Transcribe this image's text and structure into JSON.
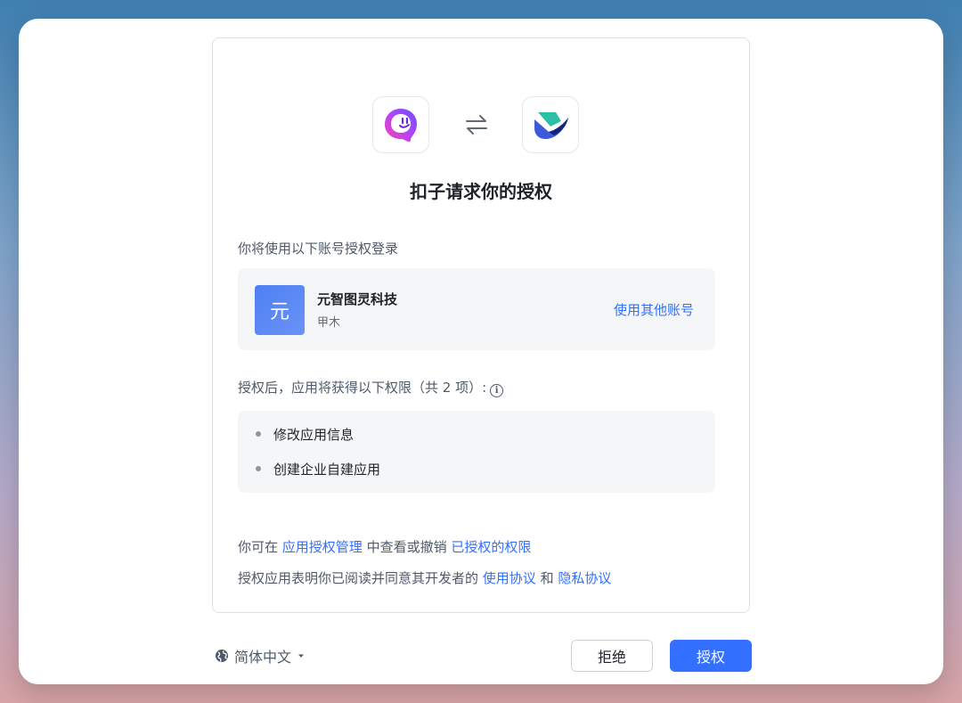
{
  "dialog": {
    "title": "扣子请求你的授权",
    "account_section_label": "你将使用以下账号授权登录",
    "account": {
      "avatar_text": "元",
      "name": "元智图灵科技",
      "sub": "甲木",
      "switch_label": "使用其他账号"
    },
    "perm_section_label": "授权后，应用将获得以下权限（共 2 项）:",
    "permissions": [
      "修改应用信息",
      "创建企业自建应用"
    ],
    "footer_line1": {
      "prefix": "你可在 ",
      "link1": "应用授权管理",
      "middle": " 中查看或撤销 ",
      "link2": "已授权的权限"
    },
    "footer_line2": {
      "prefix": "授权应用表明你已阅读并同意其开发者的 ",
      "link1": "使用协议",
      "middle": " 和 ",
      "link2": "隐私协议"
    }
  },
  "bottom_bar": {
    "language": "简体中文",
    "reject_label": "拒绝",
    "authorize_label": "授权"
  },
  "icons": {
    "left_logo": "coze-ghost-logo",
    "swap": "swap-arrows-icon",
    "right_logo": "feishu-bird-logo",
    "info": "info-icon",
    "globe": "globe-icon",
    "caret": "caret-down-icon"
  },
  "colors": {
    "accent": "#3370ff",
    "avatar": "#4e7ff2"
  }
}
